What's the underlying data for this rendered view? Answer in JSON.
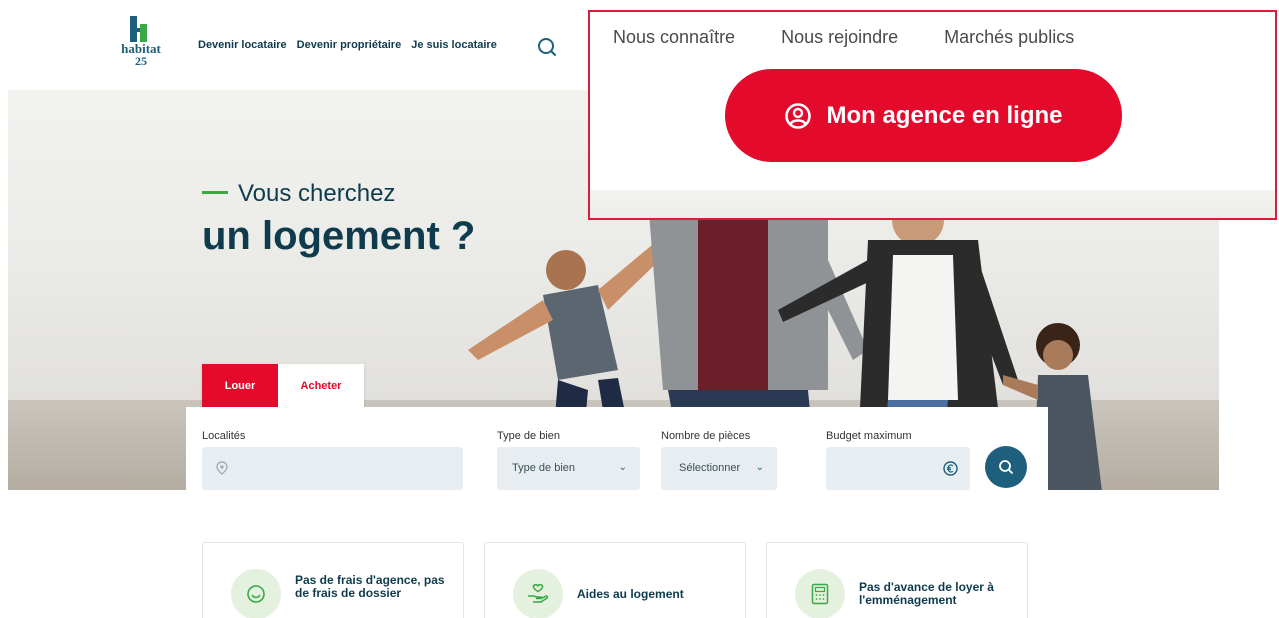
{
  "brand": {
    "name": "habitat",
    "number": "25",
    "accent": "#e30a2b",
    "primary": "#0e3b4d",
    "green": "#3aa845"
  },
  "header": {
    "nav": [
      "Devenir locataire",
      "Devenir propriétaire",
      "Je suis locataire"
    ],
    "search_icon": "search-icon"
  },
  "hero": {
    "title_line1": "Vous cherchez",
    "title_line2": "un logement ?"
  },
  "tabs": {
    "louer": "Louer",
    "acheter": "Acheter"
  },
  "search": {
    "localites_label": "Localités",
    "localites_icon": "location-pin-icon",
    "type_label": "Type de bien",
    "type_value": "Type de bien",
    "pieces_label": "Nombre de pièces",
    "pieces_value": "Sélectionner",
    "budget_label": "Budget maximum",
    "budget_icon": "euro-icon",
    "submit_icon": "search-icon"
  },
  "features": [
    {
      "text": "Pas de frais d'agence, pas de frais de dossier",
      "icon": "smile-icon"
    },
    {
      "text": "Aides au logement",
      "icon": "hand-heart-icon"
    },
    {
      "text": "Pas d'avance de loyer à l'emménagement",
      "icon": "calculator-icon"
    }
  ],
  "zoom": {
    "links": [
      "Nous connaître",
      "Nous rejoindre",
      "Marchés publics"
    ],
    "agence_label": "Mon agence en ligne",
    "agence_icon": "user-circle-icon"
  }
}
